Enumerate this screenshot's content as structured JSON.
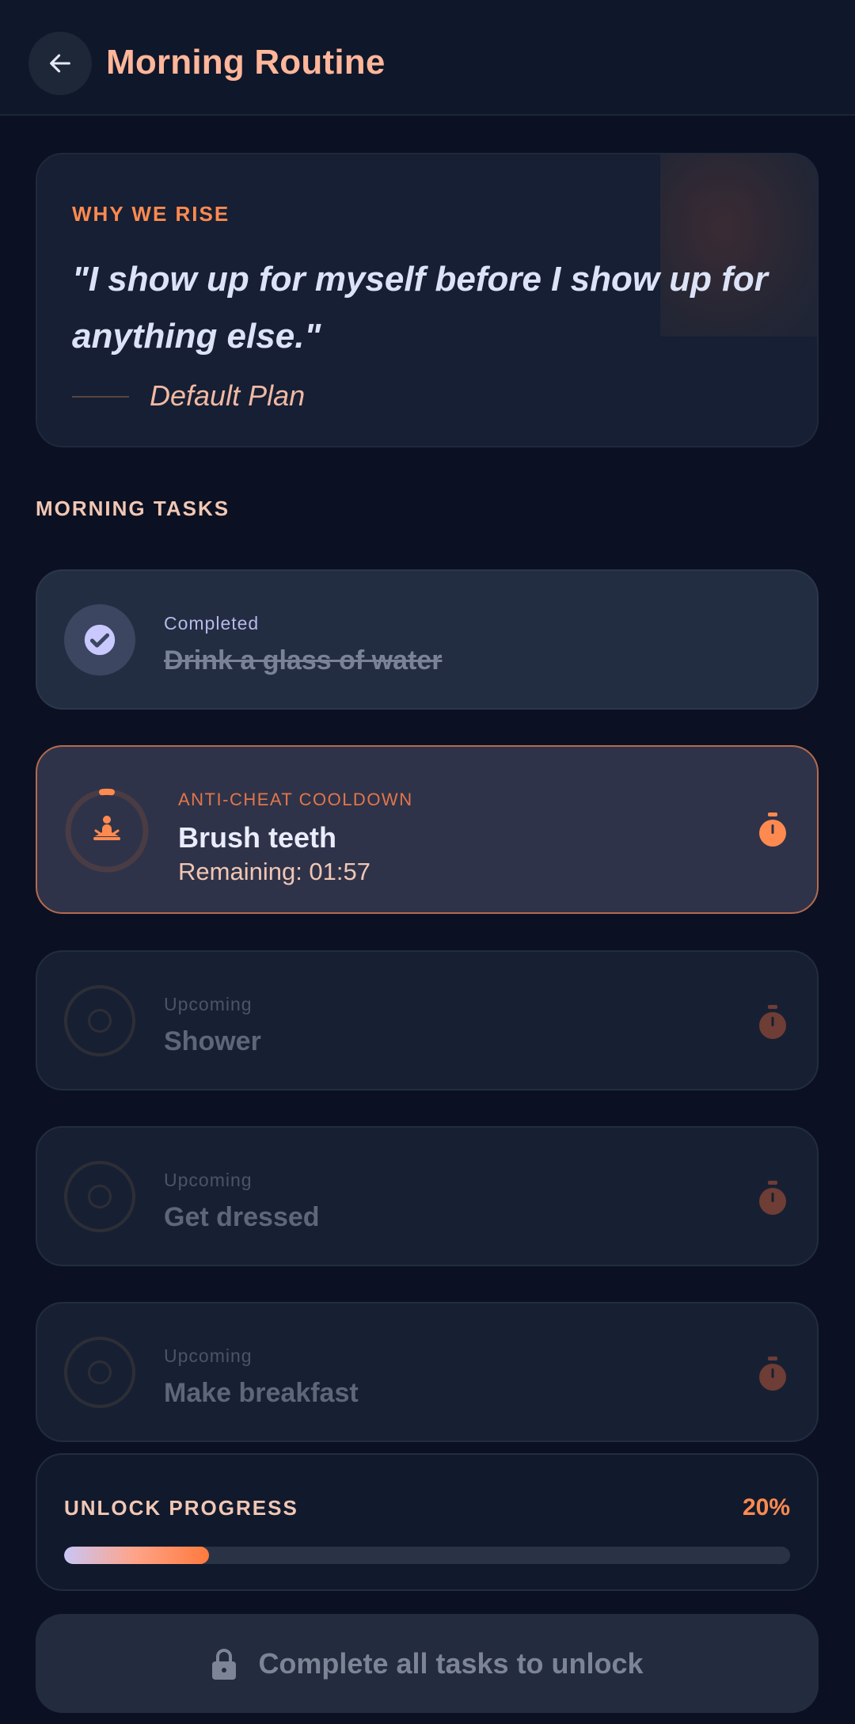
{
  "header": {
    "title": "Morning Routine",
    "back_icon": "arrow-left-icon"
  },
  "quote": {
    "eyebrow": "WHY WE RISE",
    "text": "\"I show up for myself before I show up for anything else.\"",
    "author": "Default Plan"
  },
  "tasks_section": {
    "label": "MORNING TASKS",
    "tasks": [
      {
        "status": "Completed",
        "name": "Drink a glass of water",
        "state": "done",
        "icon": "check-icon"
      },
      {
        "status": "ANTI-CHEAT COOLDOWN",
        "name": "Brush teeth",
        "remaining": "Remaining: 01:57",
        "state": "active",
        "icon": "meditation-icon",
        "timer_icon": "stopwatch-icon"
      },
      {
        "status": "Upcoming",
        "name": "Shower",
        "state": "upcoming",
        "timer_icon": "stopwatch-icon"
      },
      {
        "status": "Upcoming",
        "name": "Get dressed",
        "state": "upcoming",
        "timer_icon": "stopwatch-icon"
      },
      {
        "status": "Upcoming",
        "name": "Make breakfast",
        "state": "upcoming",
        "timer_icon": "stopwatch-icon"
      }
    ]
  },
  "progress": {
    "label": "UNLOCK PROGRESS",
    "percent_text": "20%",
    "fraction": 0.2
  },
  "unlock_button": {
    "label": "Complete all tasks to unlock",
    "icon": "lock-icon"
  },
  "colors": {
    "accent": "#ff8a50",
    "title": "#ffb69a",
    "background": "#0b1122"
  }
}
